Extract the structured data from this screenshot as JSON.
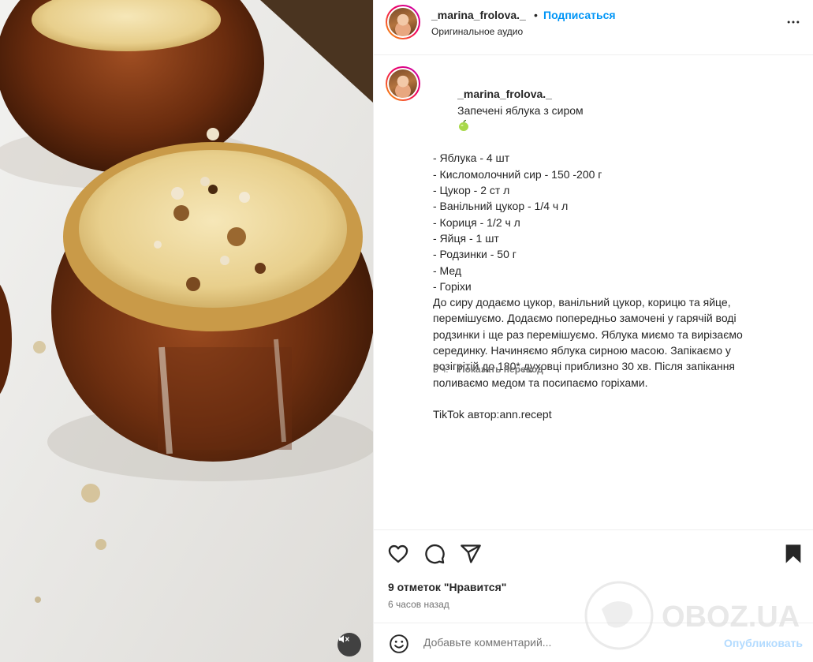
{
  "header": {
    "username": "_marina_frolova._",
    "dot": "•",
    "subscribe_label": "Подписаться",
    "audio_label": "Оригинальное аудио",
    "more_icon": "more-horizontal-icon"
  },
  "post": {
    "username": "_marina_frolova._",
    "title": "Запечені яблука з сиром",
    "title_emoji": "green-apple-icon",
    "ingredients": [
      "- Яблука - 4 шт",
      "- Кисломолочний сир - 150 -200 г",
      "- Цукор - 2 ст л",
      "- Ванільний цукор - 1/4 ч л",
      "- Кориця - 1/2 ч л",
      "- Яйця - 1 шт",
      "- Родзинки - 50 г",
      "- Мед",
      "- Горіхи"
    ],
    "instructions": [
      "До сиру додаємо цукор, ванільний цукор, корицю та яйце,",
      "перемішуємо. Додаємо попередньо замочені у гарячій воді",
      "родзинки і ще раз перемішуємо. Яблука миємо та вирізаємо",
      "серединку. Начиняємо яблука сирною масою. Запікаємо у",
      "розігрітій до 180* духовці приблизно 30 хв. Після запікання",
      "поливаємо медом та посипаємо горіхами."
    ],
    "credit": "TikTok автор:ann.recept",
    "time": "6 ч.",
    "translate_label": "Показать перевод"
  },
  "actions": {
    "likes": "9 отметок \"Нравится\"",
    "posted_ago": "6 часов назад"
  },
  "comment": {
    "placeholder": "Добавьте комментарий...",
    "publish_label": "Опубликовать"
  },
  "watermark": {
    "text": "OBOZ.UA"
  },
  "colors": {
    "accent": "#0095f6",
    "publish_disabled": "#b3dbff",
    "muted_text": "#737373",
    "text": "#262626",
    "divider": "#efefef"
  }
}
